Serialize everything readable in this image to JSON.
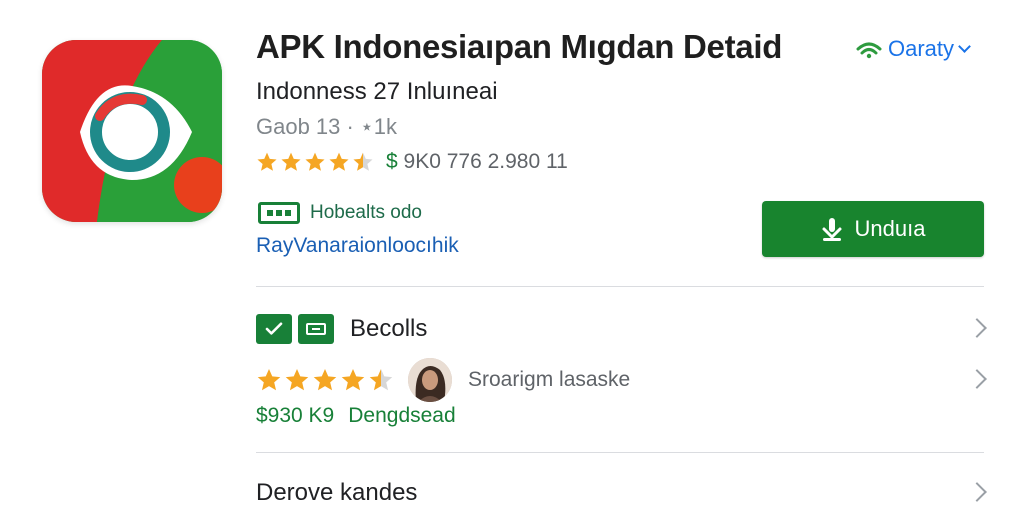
{
  "app": {
    "title": "APK Indonesiaıpan Mıgdan  Detaid",
    "publisher": "Indonness 27 Inluıneai",
    "meta": "Gaob 13  ·  ⋆1k",
    "rating_text_prefix": "$",
    "rating_text": " 9K0 776 2.980 11",
    "stars": 4.5,
    "badge_text": "Hobealts odo",
    "link_text": "RayVanaraionloocıhik"
  },
  "developer": {
    "label": "Oaraty"
  },
  "install": {
    "label": "Unduıa"
  },
  "rows": {
    "first": {
      "label": "Becolls"
    },
    "review": {
      "reviewer": "Sroarigm lasaske",
      "stars": 4.5
    },
    "price": {
      "amount": "$930  K9",
      "label": "Dengdsead"
    },
    "last": {
      "label": "Derove kandes"
    }
  },
  "colors": {
    "accent_green": "#18842e",
    "link_blue": "#1a73e8",
    "star_orange": "#f5a623"
  },
  "icons": [
    "app-logo-icon",
    "wifi-icon",
    "download-icon",
    "check-icon",
    "ticket-icon",
    "chevron-right-icon",
    "star-icon"
  ]
}
